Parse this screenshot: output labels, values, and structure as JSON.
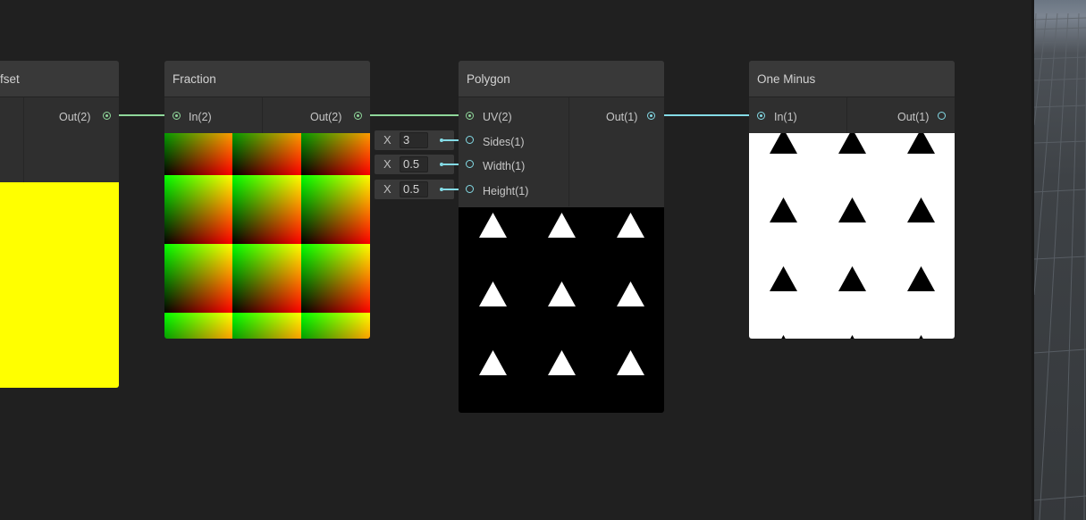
{
  "nodes": {
    "offset": {
      "title": "fset",
      "output": "Out(2)"
    },
    "fraction": {
      "title": "Fraction",
      "input": "In(2)",
      "output": "Out(2)"
    },
    "polygon": {
      "title": "Polygon",
      "input": "UV(2)",
      "output": "Out(1)",
      "params": [
        {
          "label": "Sides(1)",
          "axis": "X",
          "value": "3"
        },
        {
          "label": "Width(1)",
          "axis": "X",
          "value": "0.5"
        },
        {
          "label": "Height(1)",
          "axis": "X",
          "value": "0.5"
        }
      ]
    },
    "one_minus": {
      "title": "One Minus",
      "input": "In(1)",
      "output": "Out(1)"
    }
  },
  "colors": {
    "background": "#202020",
    "node_body": "#2f2f2f",
    "node_header": "#393939",
    "vector2_port": "#8fd79a",
    "float_port": "#84dbe6",
    "offset_preview": "#ffff00"
  }
}
